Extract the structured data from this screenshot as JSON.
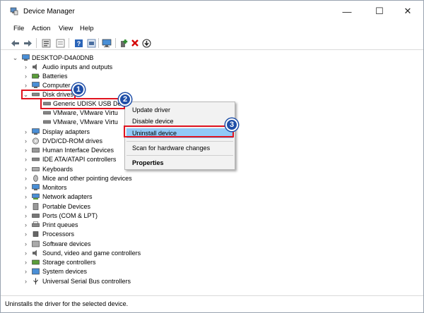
{
  "window": {
    "title": "Device Manager",
    "controls": {
      "minimize": "—",
      "maximize": "☐",
      "close": "✕"
    }
  },
  "menubar": {
    "items": [
      "File",
      "Action",
      "View",
      "Help"
    ]
  },
  "toolbar": {
    "icons": [
      "back-arrow-icon",
      "forward-arrow-icon",
      "properties-icon",
      "list-icon",
      "help-icon",
      "device-properties-icon",
      "monitor-icon",
      "add-device-icon",
      "remove-x-icon",
      "download-icon"
    ],
    "colors": {
      "remove": "#d40000",
      "add": "#2e8b2e"
    }
  },
  "tree": {
    "root": "DESKTOP-D4A0DNB",
    "categories": [
      "Audio inputs and outputs",
      "Batteries",
      "Computer",
      "Disk drives",
      "Display adapters",
      "DVD/CD-ROM drives",
      "Human Interface Devices",
      "IDE ATA/ATAPI controllers",
      "Keyboards",
      "Mice and other pointing devices",
      "Monitors",
      "Network adapters",
      "Portable Devices",
      "Ports (COM & LPT)",
      "Print queues",
      "Processors",
      "Software devices",
      "Sound, video and game controllers",
      "Storage controllers",
      "System devices",
      "Universal Serial Bus controllers"
    ],
    "disk_children": [
      "Generic UDISK USB De",
      "VMware, VMware Virtu",
      "VMware, VMware Virtu"
    ]
  },
  "context_menu": {
    "items": [
      "Update driver",
      "Disable device",
      "Uninstall device",
      "Scan for hardware changes",
      "Properties"
    ],
    "highlight_color": "#91c9f7"
  },
  "annotations": {
    "badges": [
      "1",
      "2",
      "3"
    ],
    "color": "#e0131f",
    "badge_color": "#1f4fa8"
  },
  "status": "Uninstalls the driver for the selected device."
}
